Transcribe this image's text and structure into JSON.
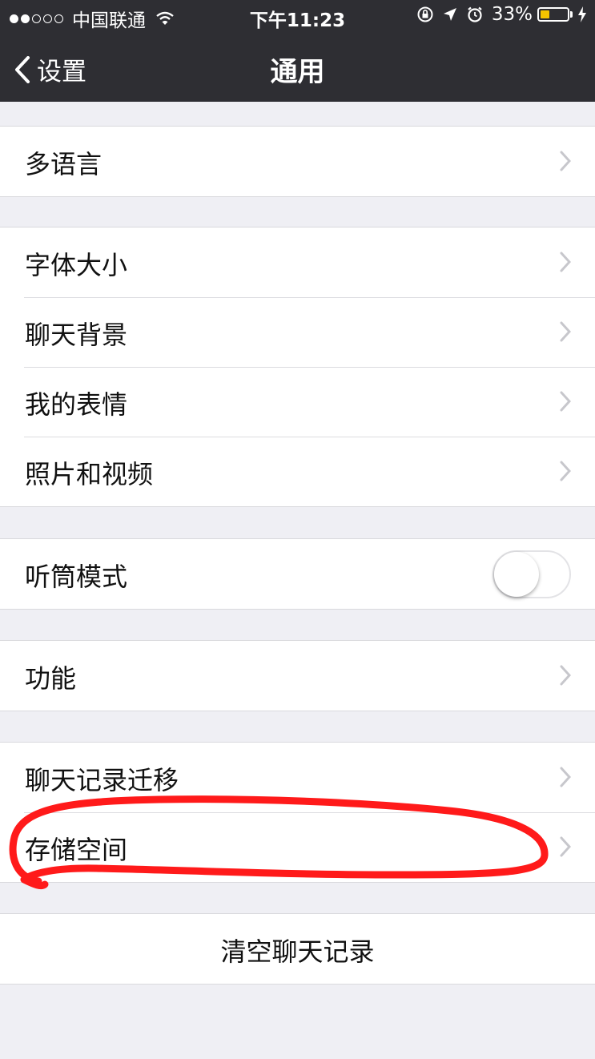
{
  "status_bar": {
    "carrier": "中国联通",
    "time": "下午11:23",
    "battery_percent": "33%",
    "battery_level": 0.33,
    "battery_color": "#f5c400",
    "icons": [
      "signal-dots-icon",
      "wifi-icon",
      "rotation-lock-icon",
      "location-arrow-icon",
      "alarm-icon",
      "battery-icon",
      "charging-bolt-icon"
    ]
  },
  "nav": {
    "back_label": "设置",
    "title": "通用"
  },
  "sections": {
    "language": {
      "label": "多语言"
    },
    "font_size": {
      "label": "字体大小"
    },
    "chat_background": {
      "label": "聊天背景"
    },
    "my_stickers": {
      "label": "我的表情"
    },
    "photos_videos": {
      "label": "照片和视频"
    },
    "earpiece_mode": {
      "label": "听筒模式",
      "enabled": false
    },
    "features": {
      "label": "功能"
    },
    "chat_migration": {
      "label": "聊天记录迁移"
    },
    "storage": {
      "label": "存储空间"
    },
    "clear_history": {
      "label": "清空聊天记录"
    }
  },
  "colors": {
    "navbar_bg": "#2e2e33",
    "page_bg": "#efeff4",
    "annotation_red": "#ff1a1a"
  }
}
